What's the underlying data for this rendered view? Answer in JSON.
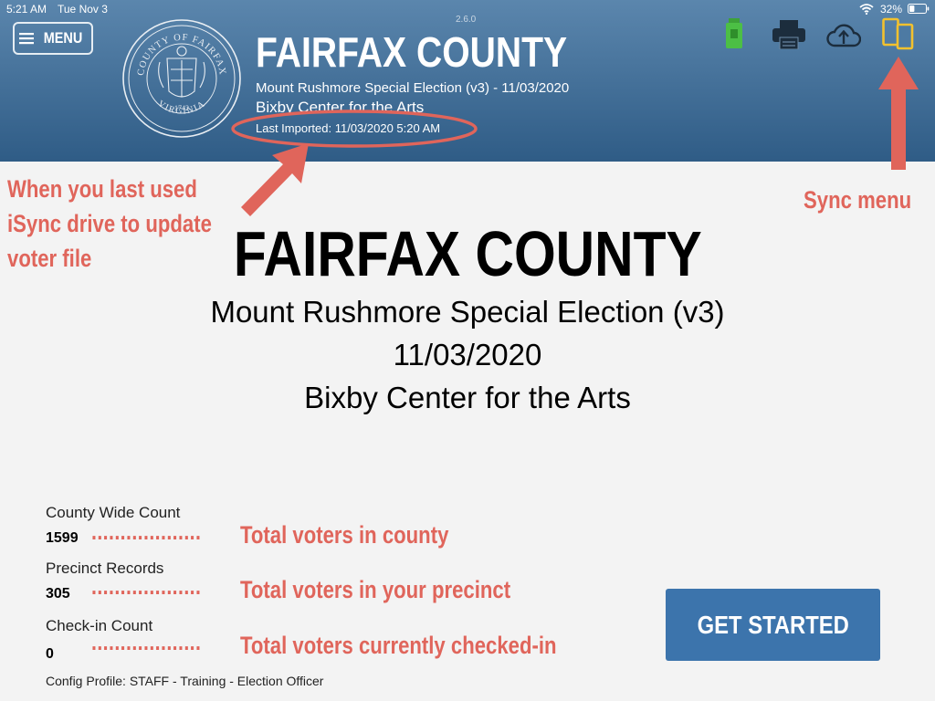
{
  "status_bar": {
    "time": "5:21 AM",
    "date": "Tue Nov 3",
    "battery_pct": "32%",
    "battery_level": 0.32
  },
  "app": {
    "version": "2.6.0"
  },
  "menu": {
    "label": "MENU",
    "icon": "hamburger-icon"
  },
  "seal": {
    "top_text": "COUNTY OF FAIRFAX",
    "bottom_text": "VIRGINIA",
    "year": "1742"
  },
  "header": {
    "title": "FAIRFAX COUNTY",
    "election_line": "Mount Rushmore Special Election (v3) - 11/03/2020",
    "location": "Bixby Center for the Arts",
    "last_imported": "Last Imported: 11/03/2020 5:20 AM"
  },
  "header_icons": {
    "usb_drive": "usb-drive-icon",
    "printer": "printer-icon",
    "cloud_upload": "cloud-upload-icon",
    "sync_devices": "sync-devices-icon"
  },
  "annotations": {
    "last_import_note": [
      "When you last used",
      "iSync drive to update",
      "voter file"
    ],
    "sync_note": "Sync menu",
    "county_note": "Total voters in county",
    "precinct_note": "Total voters in your precinct",
    "checkin_note": "Total voters currently checked-in",
    "leader_dots": "...................",
    "color": "#e0655b"
  },
  "main": {
    "title": "FAIRFAX COUNTY",
    "election": "Mount Rushmore Special Election (v3)",
    "date": "11/03/2020",
    "location": "Bixby Center for the Arts"
  },
  "stats": [
    {
      "label": "County Wide Count",
      "value": "1599"
    },
    {
      "label": "Precinct Records",
      "value": "305"
    },
    {
      "label": "Check-in Count",
      "value": "0"
    }
  ],
  "config_profile": "Config Profile:  STAFF - Training - Election Officer",
  "get_started": "GET STARTED",
  "colors": {
    "header_top": "#5b86ad",
    "header_bottom": "#2f5c86",
    "button": "#3c74ac",
    "sync_icon": "#f2c12e",
    "usb_icon": "#4cbf45"
  }
}
